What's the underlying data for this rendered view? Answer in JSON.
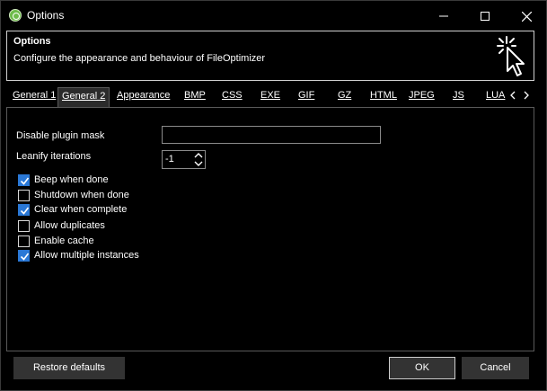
{
  "window": {
    "title": "Options"
  },
  "header": {
    "title": "Options",
    "description": "Configure the appearance and behaviour of FileOptimizer"
  },
  "tabs": [
    {
      "label": "General 1",
      "active": false
    },
    {
      "label": "General 2",
      "active": true
    },
    {
      "label": "Appearance",
      "active": false
    },
    {
      "label": "BMP",
      "active": false
    },
    {
      "label": "CSS",
      "active": false
    },
    {
      "label": "EXE",
      "active": false
    },
    {
      "label": "GIF",
      "active": false
    },
    {
      "label": "GZ",
      "active": false
    },
    {
      "label": "HTML",
      "active": false
    },
    {
      "label": "JPEG",
      "active": false
    },
    {
      "label": "JS",
      "active": false
    },
    {
      "label": "LUA",
      "active": false
    }
  ],
  "fields": {
    "disable_plugin_mask_label": "Disable plugin mask",
    "disable_plugin_mask_value": "",
    "leanify_iterations_label": "Leanify iterations",
    "leanify_iterations_value": "-1"
  },
  "checkboxes": [
    {
      "label": "Beep when done",
      "checked": true
    },
    {
      "label": "Shutdown when done",
      "checked": false
    },
    {
      "label": "Clear when complete",
      "checked": true
    },
    {
      "label": "Allow duplicates",
      "checked": false
    },
    {
      "label": "Enable cache",
      "checked": false
    },
    {
      "label": "Allow multiple instances",
      "checked": true
    }
  ],
  "buttons": {
    "restore_defaults": "Restore defaults",
    "ok": "OK",
    "cancel": "Cancel"
  },
  "colors": {
    "checkbox_checked": "#2a78d6",
    "app_icon": "#6dbb4a"
  }
}
